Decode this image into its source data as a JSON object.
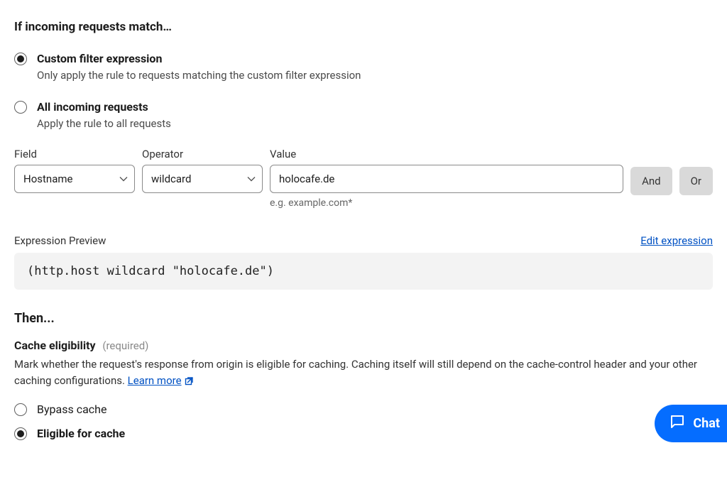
{
  "match": {
    "heading": "If incoming requests match…",
    "options": {
      "custom": {
        "title": "Custom filter expression",
        "desc": "Only apply the rule to requests matching the custom filter expression"
      },
      "all": {
        "title": "All incoming requests",
        "desc": "Apply the rule to all requests"
      }
    }
  },
  "filter": {
    "field_label": "Field",
    "operator_label": "Operator",
    "value_label": "Value",
    "field_value": "Hostname",
    "operator_value": "wildcard",
    "value_value": "holocafe.de",
    "value_hint": "e.g. example.com*",
    "and_label": "And",
    "or_label": "Or"
  },
  "preview": {
    "label": "Expression Preview",
    "edit_label": "Edit expression",
    "expression": "(http.host wildcard \"holocafe.de\")"
  },
  "then": {
    "heading": "Then...",
    "cache": {
      "title": "Cache eligibility",
      "required": "(required)",
      "desc": "Mark whether the request's response from origin is eligible for caching. Caching itself will still depend on the cache-control header and your other caching configurations. ",
      "learn_more": "Learn more",
      "bypass": "Bypass cache",
      "eligible": "Eligible for cache"
    }
  },
  "chat": {
    "label": "Chat"
  }
}
